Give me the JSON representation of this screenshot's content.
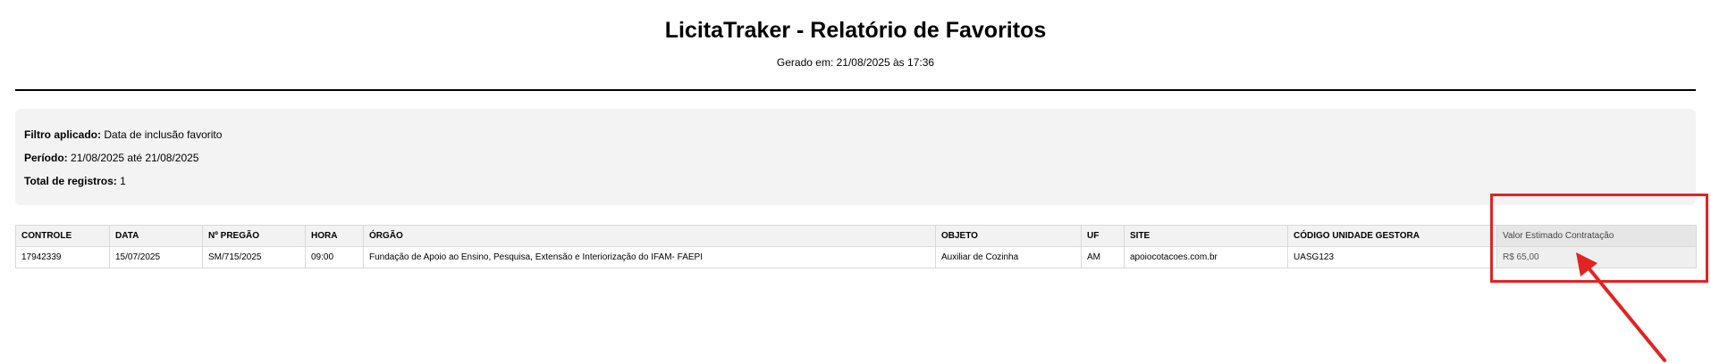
{
  "header": {
    "title": "LicitaTraker - Relatório de Favoritos",
    "generated": "Gerado em: 21/08/2025 às 17:36"
  },
  "filters": {
    "applied_label": "Filtro aplicado:",
    "applied_value": "Data de inclusão favorito",
    "period_label": "Período:",
    "period_value": "21/08/2025 até 21/08/2025",
    "total_label": "Total de registros:",
    "total_value": "1"
  },
  "table": {
    "columns": [
      "CONTROLE",
      "DATA",
      "Nº PREGÃO",
      "HORA",
      "ÓRGÃO",
      "OBJETO",
      "UF",
      "SITE",
      "CÓDIGO UNIDADE GESTORA",
      "Valor Estimado Contratação"
    ],
    "rows": [
      [
        "17942339",
        "15/07/2025",
        "SM/715/2025",
        "09:00",
        "Fundação de Apoio ao Ensino, Pesquisa, Extensão e Interiorização do IFAM- FAEPI",
        "Auxiliar de Cozinha",
        "AM",
        "apoiocotacoes.com.br",
        "UASG123",
        "R$ 65,00"
      ]
    ]
  },
  "annotation": {
    "color": "#e32322"
  }
}
